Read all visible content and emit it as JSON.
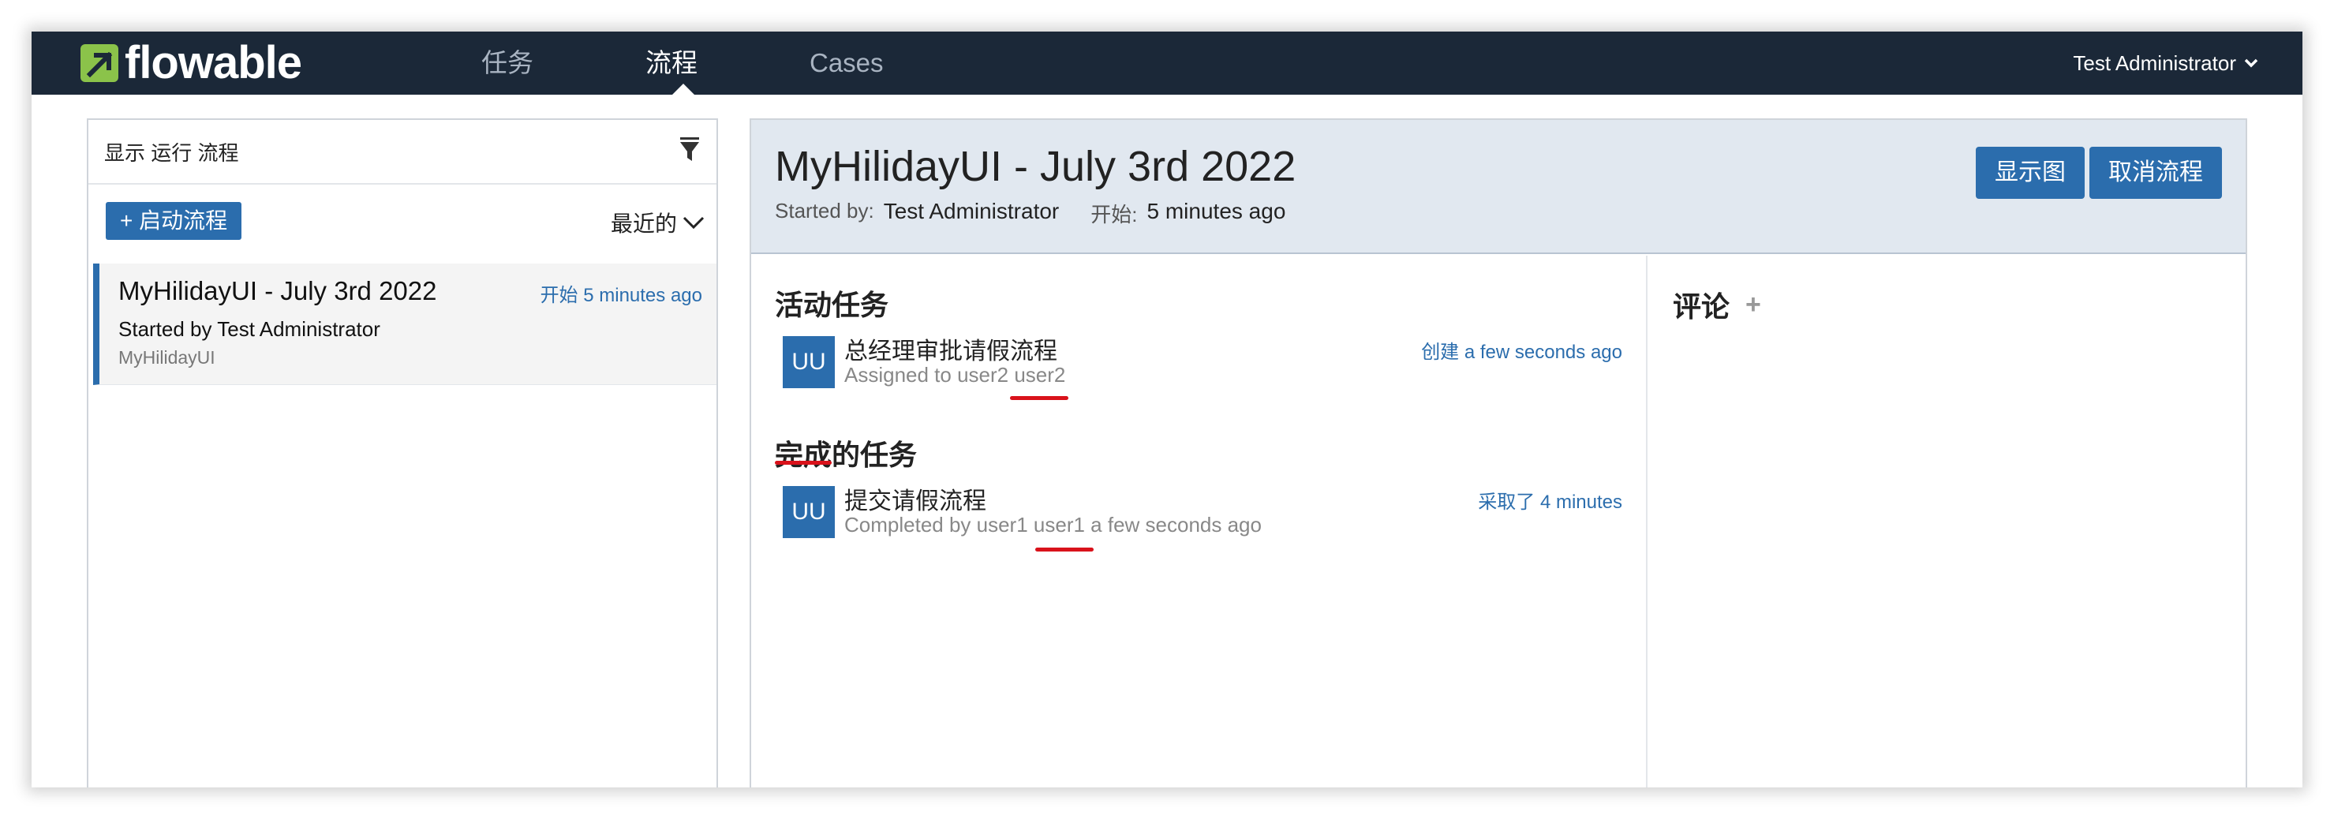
{
  "brand": {
    "name": "flowable",
    "accent": "#8bc34a"
  },
  "nav": {
    "tabs": [
      {
        "label": "任务",
        "active": false
      },
      {
        "label": "流程",
        "active": true
      },
      {
        "label": "Cases",
        "active": false
      }
    ],
    "user": "Test Administrator"
  },
  "left": {
    "filter_label": "显示 运行 流程",
    "filter_icon": "filter-icon",
    "start_button": "+ 启动流程",
    "sort_label": "最近的",
    "item": {
      "title": "MyHilidayUI - July 3rd 2022",
      "time": "开始 5 minutes ago",
      "started_by": "Started by Test Administrator",
      "definition": "MyHilidayUI"
    }
  },
  "detail": {
    "title": "MyHilidayUI - July 3rd 2022",
    "started_by_key": "Started by:",
    "started_by_val": "Test Administrator",
    "start_key": "开始:",
    "start_val": "5 minutes ago",
    "btn_diagram": "显示图",
    "btn_cancel": "取消流程",
    "active_tasks_title": "活动任务",
    "active_task": {
      "avatar": "UU",
      "name": "总经理审批请假流程",
      "sub": "Assigned to user2 user2",
      "time": "创建 a few seconds ago"
    },
    "completed_tasks_title": "完成的任务",
    "completed_task": {
      "avatar": "UU",
      "name": "提交请假流程",
      "sub": "Completed by user1 user1 a few seconds ago",
      "time": "采取了 4 minutes"
    },
    "comments_title": "评论",
    "comments_add": "+"
  },
  "colors": {
    "navbar": "#1b2838",
    "primary": "#2b6dad",
    "annotation": "#d9121b"
  }
}
